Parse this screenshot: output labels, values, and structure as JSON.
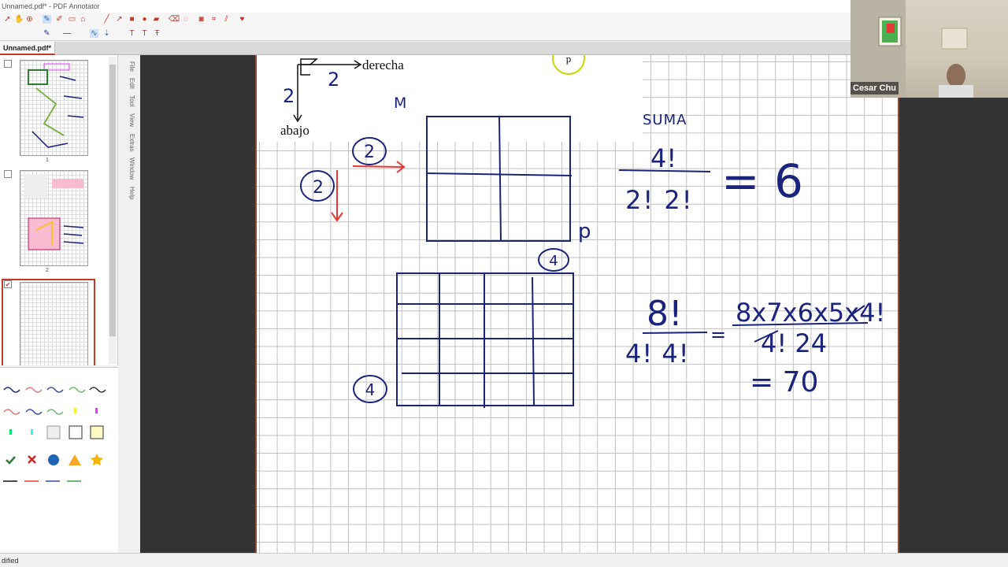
{
  "window": {
    "title": "Unnamed.pdf* - PDF Annotator",
    "tab_label": "Unnamed.pdf*",
    "status_text": "dified"
  },
  "vertical_menu": [
    "File",
    "Edit",
    "Tool",
    "View",
    "Extras",
    "Window",
    "Help"
  ],
  "thumbnails": [
    {
      "page_number": "1",
      "checked": false
    },
    {
      "page_number": "2",
      "checked": false
    },
    {
      "page_number": "3",
      "checked": true
    }
  ],
  "webcam": {
    "participant_name": "Cesar Chu"
  },
  "document": {
    "label_right": "derecha",
    "label_down": "abajo",
    "label_p": "p",
    "handwriting": {
      "two_top": "2",
      "two_left": "2",
      "letter_m": "M",
      "circled_2_top": "2",
      "circled_2_left": "2",
      "sum_label": "SUMA",
      "frac1_num": "4!",
      "frac1_den": "2! 2!",
      "frac1_result": "= 6",
      "p_mark": "p",
      "circled_4_top": "4",
      "circled_4_left": "4",
      "frac2_num": "8!",
      "frac2_den": "4! 4!",
      "frac2_eq": "=",
      "frac3_num": "8x7x6x5x4!",
      "frac3_den": "4! 24",
      "frac3_result": "= 70"
    }
  },
  "colors": {
    "ink_navy": "#1a237e",
    "ink_red": "#e53935",
    "accent": "#c0392b"
  }
}
